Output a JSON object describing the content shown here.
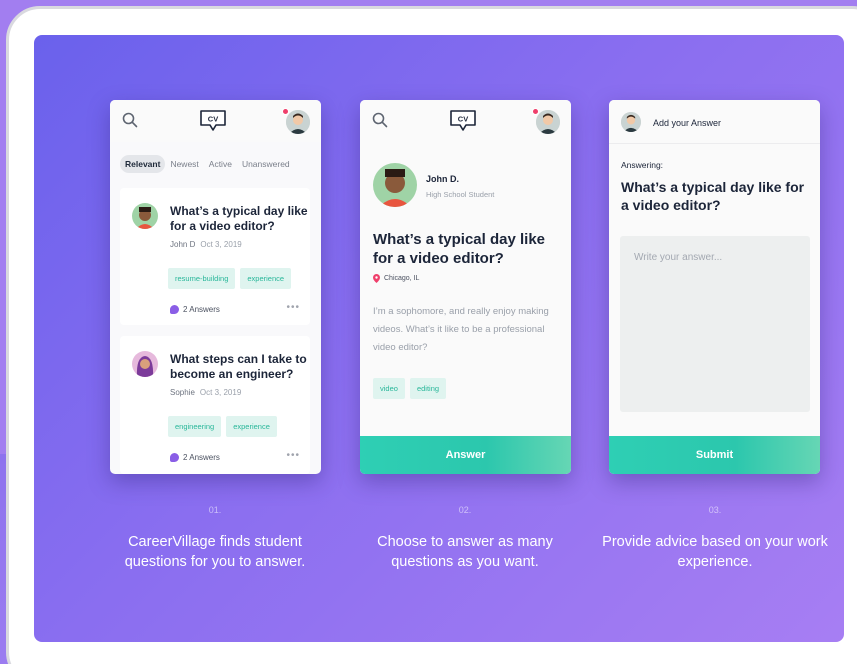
{
  "steps": [
    {
      "number": "01.",
      "caption": "CareerVillage finds student questions for you to answer.",
      "filters": [
        "Relevant",
        "Newest",
        "Active",
        "Unanswered"
      ],
      "questions": [
        {
          "title": "What’s a typical day like for a video editor?",
          "author": "John D",
          "date": "Oct 3, 2019",
          "tags": [
            "resume-building",
            "experience"
          ],
          "answers": "2 Answers"
        },
        {
          "title": "What steps can I take to become an engineer?",
          "author": "Sophie",
          "date": "Oct 3, 2019",
          "tags": [
            "engineering",
            "experience"
          ],
          "answers": "2 Answers"
        }
      ]
    },
    {
      "number": "02.",
      "caption": "Choose to answer as many questions as you want.",
      "author_name": "John D.",
      "author_role": "High School Student",
      "question": "What’s a typical day like for a video editor?",
      "location": "Chicago, IL",
      "body": "I’m a sophomore, and really enjoy making videos. What’s it like to be a professional video editor?",
      "tags": [
        "video",
        "editing"
      ],
      "button": "Answer"
    },
    {
      "number": "03.",
      "caption": "Provide advice based on your work experience.",
      "header": "Add your Answer",
      "answering_label": "Answering:",
      "question": "What’s a typical day like for a video editor?",
      "placeholder": "Write your answer...",
      "button": "Submit"
    }
  ],
  "logo_text": "CV",
  "colors": {
    "accent": "#2ecfb4",
    "tag_bg": "#dff4ef",
    "notification": "#ef3f6b",
    "panel_from": "#6a61ec",
    "panel_to": "#a77ef3"
  }
}
